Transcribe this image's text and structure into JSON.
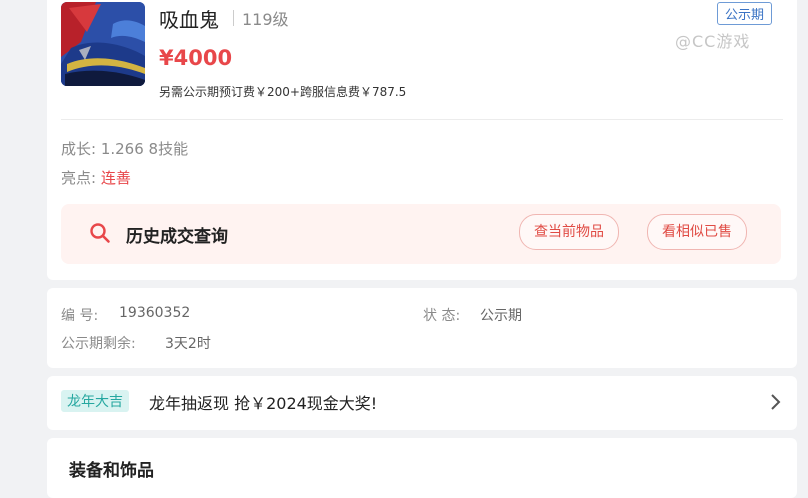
{
  "item": {
    "name": "吸血鬼",
    "level": "119级",
    "price": "¥4000",
    "fees": "另需公示期预订费￥200+跨服信息费￥787.5",
    "status_badge": "公示期",
    "watermark": "@CC游戏"
  },
  "attributes": {
    "growth": "成长: 1.266 8技能",
    "highlight_label": "亮点:",
    "highlight_value": "连善"
  },
  "history": {
    "label": "历史成交查询",
    "btn_current": "查当前物品",
    "btn_similar": "看相似已售"
  },
  "info": {
    "serial_label": "编 号:",
    "serial_value": "19360352",
    "status_label": "状 态:",
    "status_value": "公示期",
    "remaining_label": "公示期剩余:",
    "remaining_value": "3天2时"
  },
  "promo": {
    "tag": "龙年大吉",
    "text": "龙年抽返现 抢￥2024现金大奖!"
  },
  "equipment": {
    "title": "装备和饰品"
  },
  "colors": {
    "accent_red": "#e8474a",
    "badge_blue": "#3a73c4",
    "promo_teal": "#26a7a0"
  }
}
